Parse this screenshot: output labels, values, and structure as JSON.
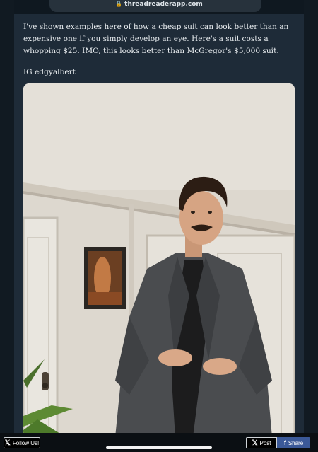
{
  "browser": {
    "url": "threadreaderapp.com"
  },
  "tweet": {
    "text": "I've shown examples here of how a cheap suit can look better than an expensive one if you simply develop an eye. Here's a suit costs a whopping $25. IMO, this looks better than McGregor's $5,000 suit.",
    "credit": "IG edgyalbert"
  },
  "actions": {
    "follow_label": "Follow Us!",
    "post_label": "Post",
    "share_label": "Share"
  },
  "colors": {
    "background": "#1e2b38",
    "share_button": "#3b5998"
  }
}
